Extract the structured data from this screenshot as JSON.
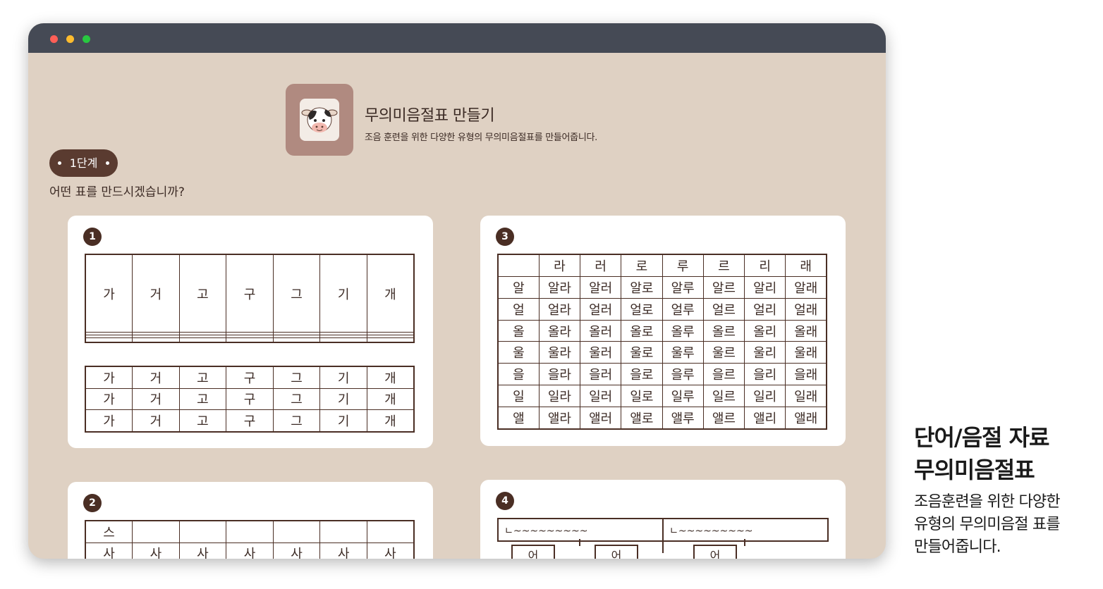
{
  "window": {
    "traffic_lights": [
      "#ff5f57",
      "#febc2e",
      "#28c840"
    ]
  },
  "header": {
    "title": "무의미음절표 만들기",
    "subtitle": "조음 훈련을 위한 다양한 유형의 무의미음절표를 만들어줍니다.",
    "icon": "cow-icon"
  },
  "step": {
    "label": "1단계",
    "question": "어떤 표를 만드시겠습니까?"
  },
  "cards": [
    {
      "number": "1",
      "table_a": [
        [
          "가",
          "거",
          "고",
          "구",
          "그",
          "기",
          "개"
        ],
        [
          "",
          "",
          "",
          "",
          "",
          "",
          ""
        ],
        [
          "",
          "",
          "",
          "",
          "",
          "",
          ""
        ],
        [
          "",
          "",
          "",
          "",
          "",
          "",
          ""
        ]
      ],
      "table_b": [
        [
          "가",
          "거",
          "고",
          "구",
          "그",
          "기",
          "개"
        ],
        [
          "가",
          "거",
          "고",
          "구",
          "그",
          "기",
          "개"
        ],
        [
          "가",
          "거",
          "고",
          "구",
          "그",
          "기",
          "개"
        ]
      ]
    },
    {
      "number": "3",
      "rows": [
        [
          "",
          "라",
          "러",
          "로",
          "루",
          "르",
          "리",
          "래"
        ],
        [
          "알",
          "알라",
          "알러",
          "알로",
          "알루",
          "알르",
          "알리",
          "알래"
        ],
        [
          "얼",
          "얼라",
          "얼러",
          "얼로",
          "얼루",
          "얼르",
          "얼리",
          "얼래"
        ],
        [
          "올",
          "올라",
          "올러",
          "올로",
          "올루",
          "올르",
          "올리",
          "올래"
        ],
        [
          "울",
          "울라",
          "울러",
          "울로",
          "울루",
          "울르",
          "울리",
          "울래"
        ],
        [
          "을",
          "을라",
          "을러",
          "을로",
          "을루",
          "을르",
          "을리",
          "을래"
        ],
        [
          "일",
          "일라",
          "일러",
          "일로",
          "일루",
          "일르",
          "일리",
          "일래"
        ],
        [
          "앨",
          "앨라",
          "앨러",
          "앨로",
          "앨루",
          "앨르",
          "앨리",
          "앨래"
        ]
      ]
    },
    {
      "number": "2",
      "rows": [
        [
          "스",
          "",
          "",
          "",
          "",
          "",
          ""
        ],
        [
          "사",
          "사",
          "사",
          "사",
          "사",
          "사",
          "사"
        ]
      ]
    },
    {
      "number": "4",
      "box_labels": [
        "ㄴ~~~~~~~~~",
        "ㄴ~~~~~~~~~"
      ],
      "small_labels": [
        "어",
        "어",
        "어"
      ]
    }
  ],
  "side_panel": {
    "title_line1": "단어/음절 자료",
    "title_line2": "무의미음절표",
    "desc_line1": "조음훈련을 위한 다양한",
    "desc_line2": "유형의 무의미음절 표를",
    "desc_line3": "만들어줍니다."
  }
}
